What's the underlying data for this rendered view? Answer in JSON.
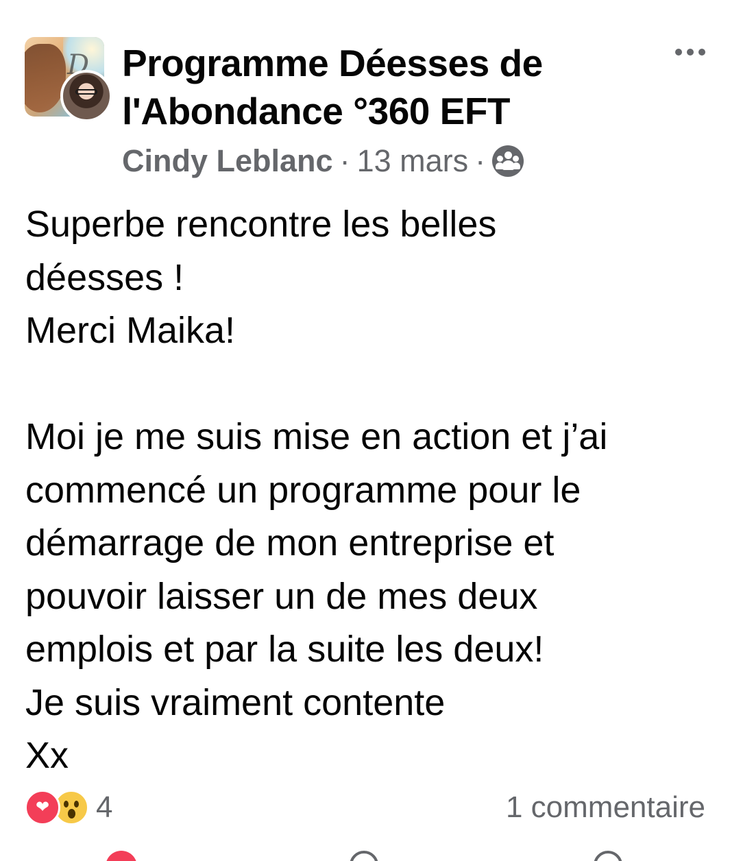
{
  "group": {
    "name": "Programme Déesses de l'Abondance °360 EFT",
    "avatar_icon": "group-cover-photo",
    "member_avatar_icon": "member-profile-photo"
  },
  "post": {
    "author": "Cindy Leblanc",
    "separator": "·",
    "date": "13 mars",
    "audience_icon": "group-members-icon",
    "text": "Superbe rencontre les belles\ndéesses !\nMerci Maika!\n\nMoi je me suis mise en action et j’ai\ncommencé un programme pour le\ndémarrage de mon entreprise et\npouvoir laisser un de mes deux\nemplois et par la suite les deux!\nJe suis vraiment contente\nXx"
  },
  "more_icon": "more-options-icon",
  "reactions": {
    "types": [
      "love",
      "wow"
    ],
    "count": "4"
  },
  "comments": {
    "label": "1 commentaire"
  },
  "colors": {
    "text_primary": "#050505",
    "text_secondary": "#65676b",
    "love": "#f33e58",
    "wow": "#f7c948"
  }
}
